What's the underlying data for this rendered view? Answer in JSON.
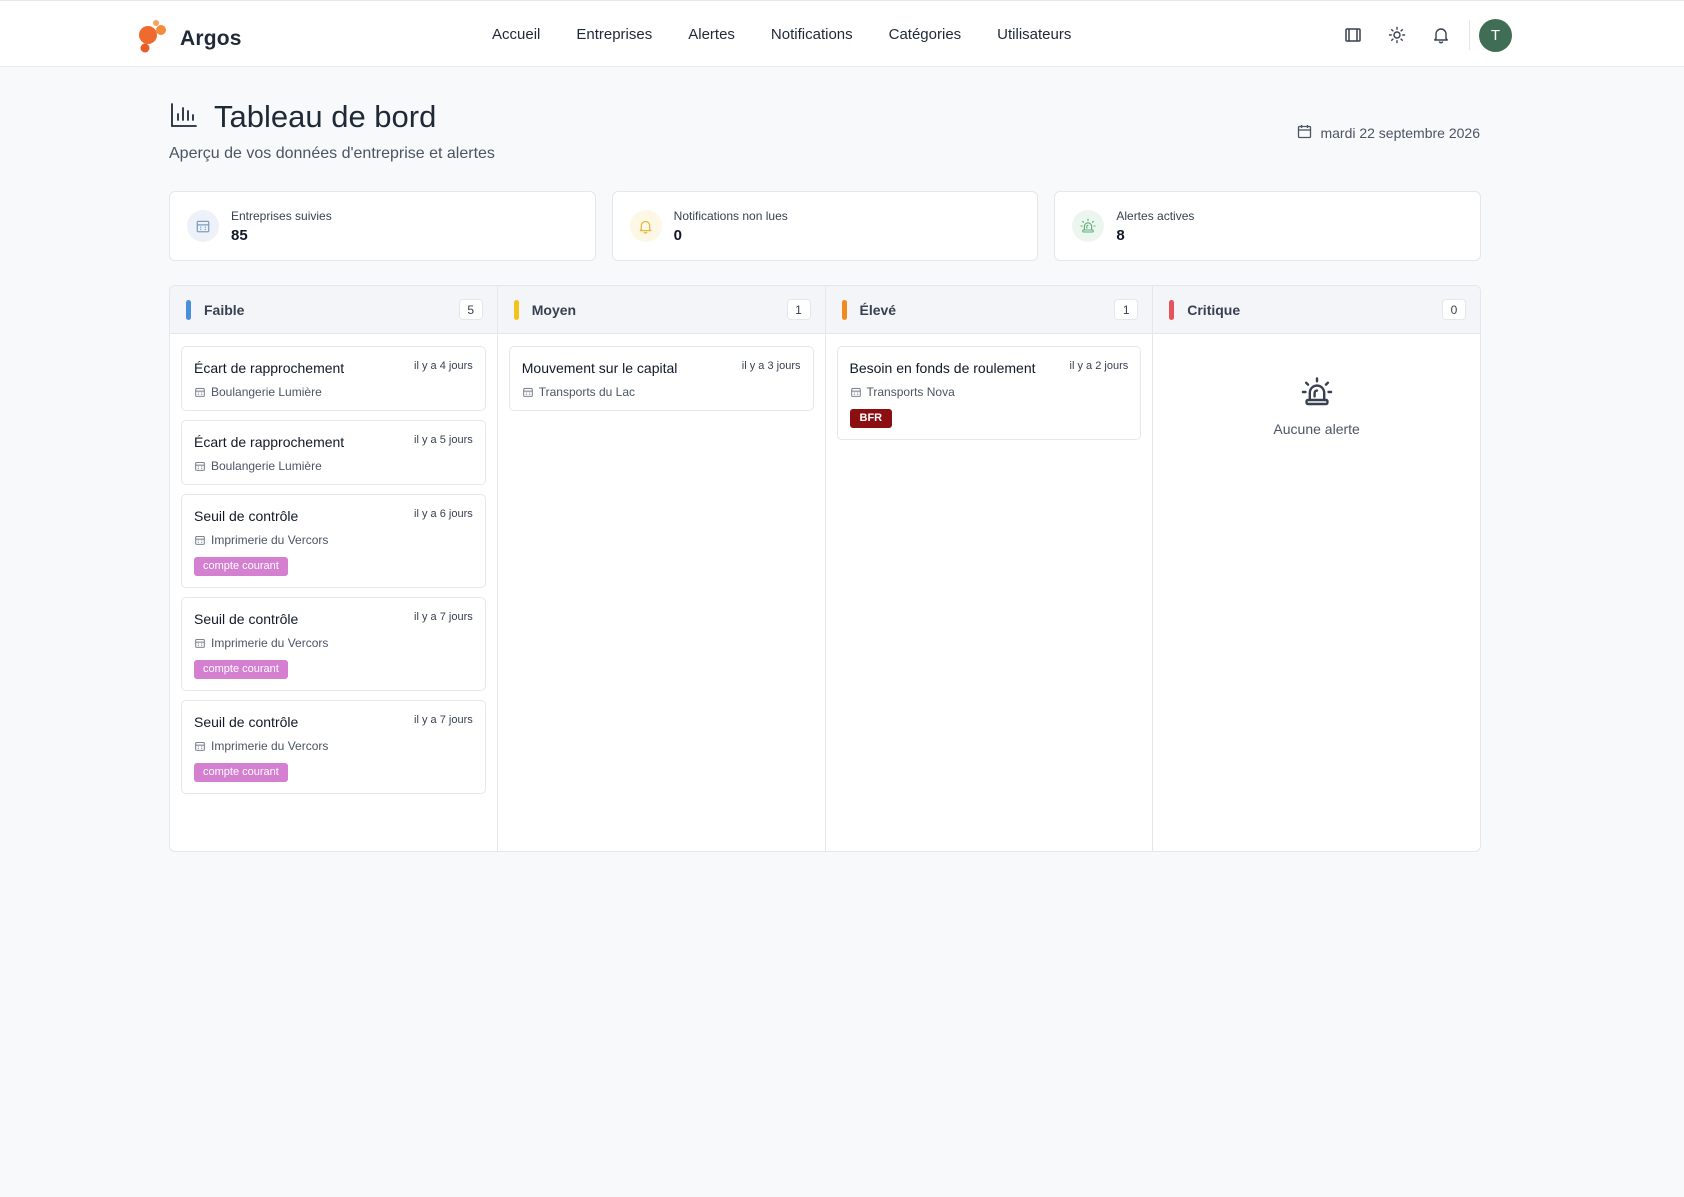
{
  "app": {
    "name": "Argos"
  },
  "nav": [
    "Accueil",
    "Entreprises",
    "Alertes",
    "Notifications",
    "Catégories",
    "Utilisateurs"
  ],
  "user": {
    "initial": "T"
  },
  "page": {
    "title": "Tableau de bord",
    "subtitle": "Aperçu de vos données d'entreprise et alertes",
    "date": "mardi 22 septembre 2026"
  },
  "stats": [
    {
      "label": "Entreprises suivies",
      "value": "85",
      "icon": "building-icon",
      "color": "#7c9cc7",
      "bg": "#eef2f8"
    },
    {
      "label": "Notifications non lues",
      "value": "0",
      "icon": "bell-icon",
      "color": "#e2b93b",
      "bg": "#fdf7e6"
    },
    {
      "label": "Alertes actives",
      "value": "8",
      "icon": "siren-icon",
      "color": "#5fae7b",
      "bg": "#ecf6ef"
    }
  ],
  "columns": [
    {
      "title": "Faible",
      "count": "5",
      "color": "#4a90d9",
      "cards": [
        {
          "title": "Écart de rapprochement",
          "time": "il y a 4 jours",
          "company": "Boulangerie Lumière"
        },
        {
          "title": "Écart de rapprochement",
          "time": "il y a 5 jours",
          "company": "Boulangerie Lumière"
        },
        {
          "title": "Seuil de contrôle",
          "time": "il y a 6 jours",
          "company": "Imprimerie du Vercors",
          "tag": "compte courant"
        },
        {
          "title": "Seuil de contrôle",
          "time": "il y a 7 jours",
          "company": "Imprimerie du Vercors",
          "tag": "compte courant"
        },
        {
          "title": "Seuil de contrôle",
          "time": "il y a 7 jours",
          "company": "Imprimerie du Vercors",
          "tag": "compte courant"
        }
      ]
    },
    {
      "title": "Moyen",
      "count": "1",
      "color": "#f2c318",
      "cards": [
        {
          "title": "Mouvement sur le capital",
          "time": "il y a 3 jours",
          "company": "Transports du Lac"
        }
      ]
    },
    {
      "title": "Élevé",
      "count": "1",
      "color": "#f08c1b",
      "cards": [
        {
          "title": "Besoin en fonds de roulement",
          "time": "il y a 2 jours",
          "company": "Transports Nova",
          "tag": "BFR",
          "tag_style": "dark"
        }
      ]
    },
    {
      "title": "Critique",
      "count": "0",
      "color": "#e5535b",
      "cards": [],
      "empty": "Aucune alerte"
    }
  ]
}
